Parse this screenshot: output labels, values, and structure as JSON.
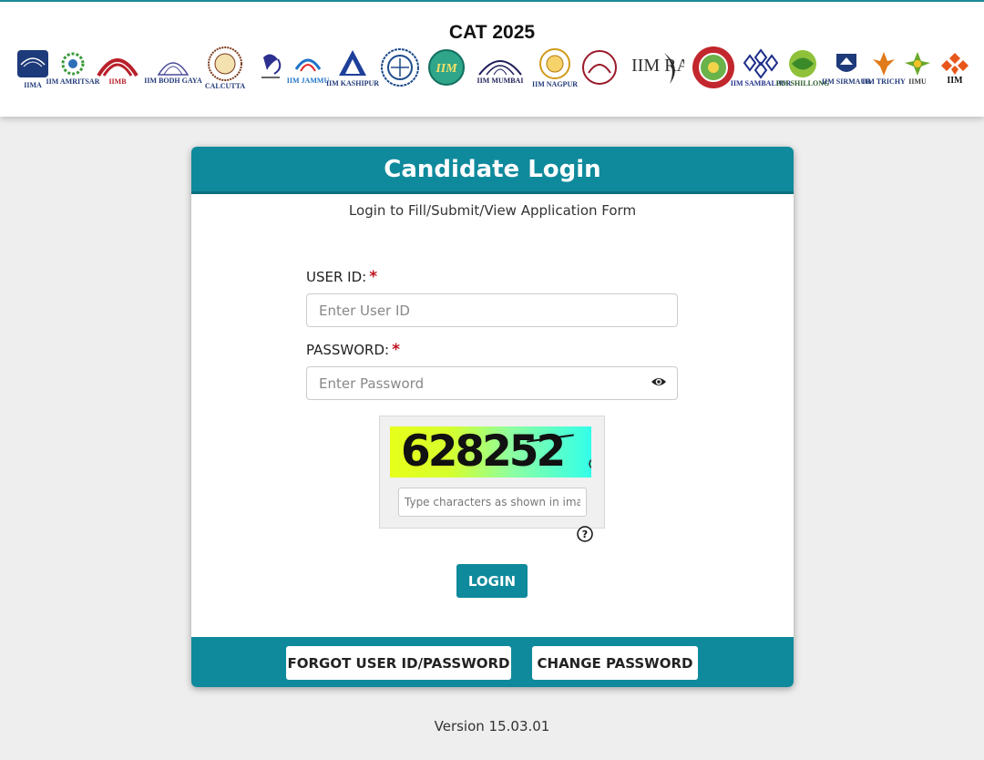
{
  "header": {
    "title": "CAT 2025",
    "logos": [
      {
        "text": "IIMA",
        "icon": "iima-logo"
      },
      {
        "text": "IIM AMRITSAR",
        "icon": "iim-amritsar-logo"
      },
      {
        "text": "IIMB",
        "icon": "iimb-logo"
      },
      {
        "text": "IIM BODH GAYA",
        "icon": "iim-bodh-gaya-logo"
      },
      {
        "text": "CALCUTTA",
        "icon": "iim-calcutta-logo"
      },
      {
        "text": "",
        "icon": "iim-indore-logo"
      },
      {
        "text": "IIM JAMMU",
        "icon": "iim-jammu-logo"
      },
      {
        "text": "IIM KASHIPUR",
        "icon": "iim-kashipur-logo"
      },
      {
        "text": "",
        "icon": "iim-kozhikode-logo"
      },
      {
        "text": "IIM",
        "icon": "iim-lucknow-logo"
      },
      {
        "text": "IIM MUMBAI",
        "icon": "iim-mumbai-logo"
      },
      {
        "text": "IIM NAGPUR",
        "icon": "iim-nagpur-logo"
      },
      {
        "text": "",
        "icon": "iim-rohtak-logo"
      },
      {
        "text": "IIM RANCHI",
        "icon": "iim-ranchi-logo"
      },
      {
        "text": "",
        "icon": "iim-raipur-logo"
      },
      {
        "text": "IIM SAMBALPUR",
        "icon": "iim-sambalpur-logo"
      },
      {
        "text": "IIM SHILLONG",
        "icon": "iim-shillong-logo"
      },
      {
        "text": "IIM SIRMAUR",
        "icon": "iim-sirmaur-logo"
      },
      {
        "text": "IIM TRICHY",
        "icon": "iim-trichy-logo"
      },
      {
        "text": "IIMU",
        "icon": "iim-udaipur-logo"
      },
      {
        "text": "IIM",
        "icon": "iim-visakhapatnam-logo"
      }
    ]
  },
  "login": {
    "title": "Candidate Login",
    "subtitle": "Login to Fill/Submit/View Application Form",
    "user_id_label": "USER ID:",
    "user_id_placeholder": "Enter User ID",
    "password_label": "PASSWORD:",
    "password_placeholder": "Enter Password",
    "required_mark": "*",
    "captcha_text": "628252",
    "captcha_placeholder": "Type characters as shown in image",
    "login_button": "LOGIN",
    "forgot_button": "FORGOT USER ID/PASSWORD",
    "change_password_button": "CHANGE PASSWORD"
  },
  "footer": {
    "version": "Version 15.03.01"
  },
  "colors": {
    "accent": "#0f8a9c",
    "required": "#c0141e",
    "background": "#eeeeee"
  }
}
